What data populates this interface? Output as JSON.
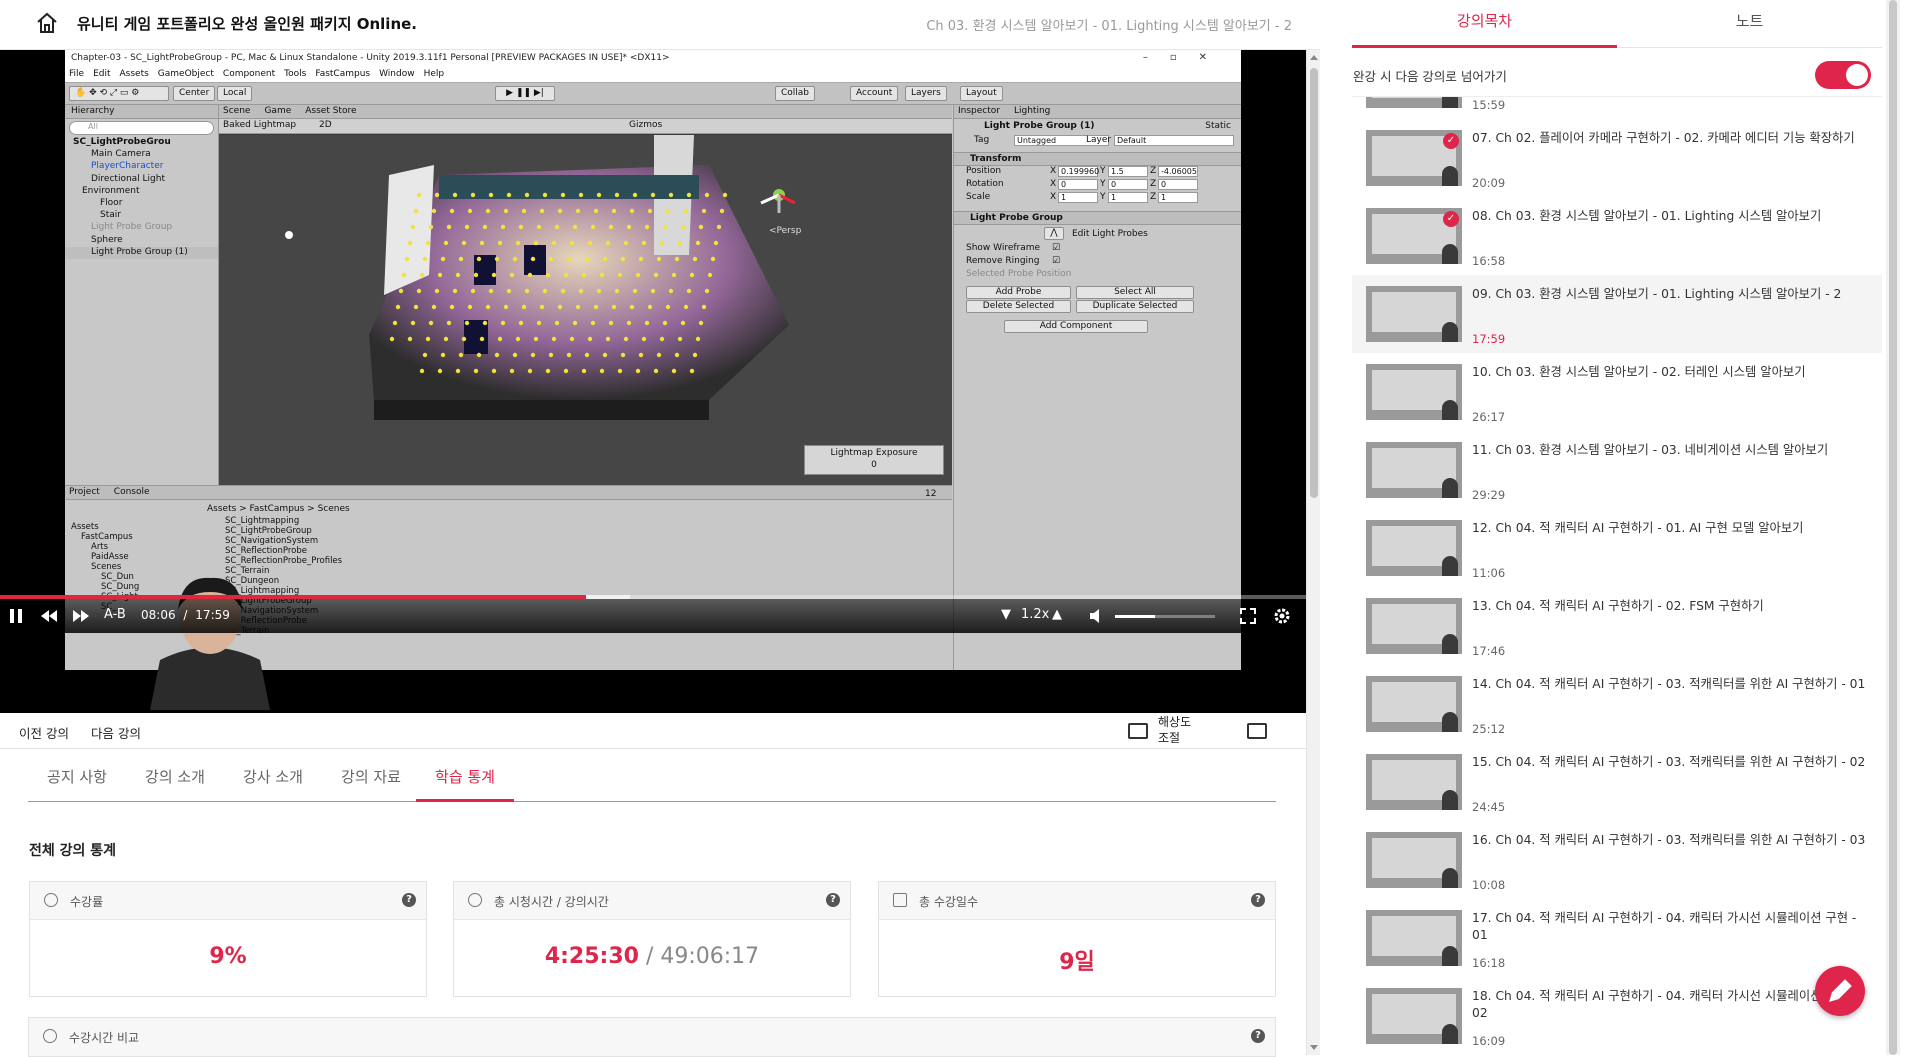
{
  "header": {
    "course_title": "유니티 게임 포트폴리오 완성 올인원 패키지 Online.",
    "chapter_title": "Ch 03. 환경 시스템 알아보기 - 01. Lighting 시스템 알아보기 - 2"
  },
  "unity": {
    "window_title": "Chapter-03 - SC_LightProbeGroup - PC, Mac & Linux Standalone - Unity 2019.3.11f1 Personal [PREVIEW PACKAGES IN USE]* <DX11>",
    "menu": [
      "File",
      "Edit",
      "Assets",
      "GameObject",
      "Component",
      "Tools",
      "FastCampus",
      "Window",
      "Help"
    ],
    "toolbar": {
      "center": "Center",
      "local": "Local",
      "collab": "Collab",
      "account": "Account",
      "layers": "Layers",
      "layout": "Layout"
    },
    "hierarchy_title": "Hierarchy",
    "search_all": "All",
    "hierarchy": [
      {
        "label": "SC_LightProbeGrou",
        "indent": 0,
        "style": "bold"
      },
      {
        "label": "Main Camera",
        "indent": 2,
        "style": ""
      },
      {
        "label": "PlayerCharacter",
        "indent": 2,
        "style": "blue"
      },
      {
        "label": "Directional Light",
        "indent": 2,
        "style": ""
      },
      {
        "label": "Environment",
        "indent": 1,
        "style": ""
      },
      {
        "label": "Floor",
        "indent": 3,
        "style": ""
      },
      {
        "label": "Stair",
        "indent": 3,
        "style": ""
      },
      {
        "label": "Light Probe Group",
        "indent": 2,
        "style": "grey"
      },
      {
        "label": "Sphere",
        "indent": 2,
        "style": ""
      },
      {
        "label": "Light Probe Group (1)",
        "indent": 2,
        "style": "sel"
      }
    ],
    "scene_tabs": [
      "Scene",
      "Game",
      "Asset Store"
    ],
    "scene_mode": "Baked Lightmap",
    "scene_2d": "2D",
    "gizmos": "Gizmos",
    "persp": "<Persp",
    "lightmap_exposure": "Lightmap Exposure",
    "lightmap_value": "0",
    "inspector_tabs": [
      "Inspector",
      "Lighting"
    ],
    "object_name": "Light Probe Group (1)",
    "static": "Static",
    "tag_label": "Tag",
    "tag_value": "Untagged",
    "layer_label": "Layer",
    "layer_value": "Default",
    "transform_title": "Transform",
    "position_label": "Position",
    "rotation_label": "Rotation",
    "scale_label": "Scale",
    "position": [
      "0.199960",
      "1.5",
      "-4.06005"
    ],
    "rotation": [
      "0",
      "0",
      "0"
    ],
    "scale": [
      "1",
      "1",
      "1"
    ],
    "lpg_title": "Light Probe Group",
    "edit_light_probes": "Edit Light Probes",
    "show_wireframe": "Show Wireframe",
    "remove_ringing": "Remove Ringing",
    "selected_probe_position": "Selected Probe Position",
    "add_probe": "Add Probe",
    "select_all": "Select All",
    "delete_selected": "Delete Selected",
    "duplicate_selected": "Duplicate Selected",
    "add_component": "Add Component",
    "project_tabs": [
      "Project",
      "Console"
    ],
    "breadcrumb": "Assets > FastCampus > Scenes",
    "folders": [
      "Assets",
      "FastCampus",
      "Arts",
      "PaidAsse",
      "Scenes",
      "SC_Dun",
      "SC_Dung",
      "SC_Light",
      "SC_"
    ],
    "files": [
      "SC_Lightmapping",
      "SC_LightProbeGroup",
      "SC_NavigationSystem",
      "SC_ReflectionProbe",
      "SC_ReflectionProbe_Profiles",
      "SC_Terrain",
      "SC_Dungeon",
      "SC_Lightmapping",
      "SC_LightProbeGroup",
      "SC_NavigationSystem",
      "SC_ReflectionProbe",
      "SC_Terrain"
    ],
    "item_count": "12"
  },
  "player": {
    "ab": "A-B",
    "current_time": "08:06",
    "separator": "/",
    "duration": "17:59",
    "speed": "1.2x",
    "progress": 0.449
  },
  "subbar": {
    "prev": "이전 강의",
    "next": "다음 강의",
    "resolution": "해상도\n조절"
  },
  "tabs": [
    "공지 사항",
    "강의 소개",
    "강사 소개",
    "강의 자료",
    "학습 통계"
  ],
  "active_tab": 4,
  "stats": {
    "title": "전체 강의 통계",
    "cards": [
      {
        "label": "수강률",
        "value": "9%",
        "muted": ""
      },
      {
        "label": "총 시청시간 / 강의시간",
        "value": "4:25:30",
        "muted": " / 49:06:17"
      },
      {
        "label": "총 수강일수",
        "value": "9일",
        "muted": ""
      }
    ],
    "compare_label": "수강시간 비교"
  },
  "rpanel": {
    "tabs": [
      "강의목차",
      "노트"
    ],
    "autoplay_label": "완강 시 다음 강의로 넘어가기",
    "autoplay_on": true,
    "items": [
      {
        "title": "",
        "time": "15:59",
        "checked": false,
        "current": false
      },
      {
        "title": "07. Ch 02. 플레이어 카메라 구현하기 - 02. 카메라 에디터 기능 확장하기",
        "time": "20:09",
        "checked": true,
        "current": false
      },
      {
        "title": "08. Ch 03. 환경 시스템 알아보기 - 01. Lighting 시스템 알아보기",
        "time": "16:58",
        "checked": true,
        "current": false
      },
      {
        "title": "09. Ch 03. 환경 시스템 알아보기 - 01. Lighting 시스템 알아보기 - 2",
        "time": "17:59",
        "checked": false,
        "current": true
      },
      {
        "title": "10. Ch 03. 환경 시스템 알아보기 - 02. 터레인 시스템 알아보기",
        "time": "26:17",
        "checked": false,
        "current": false
      },
      {
        "title": "11. Ch 03. 환경 시스템 알아보기 - 03. 네비게이션 시스템 알아보기",
        "time": "29:29",
        "checked": false,
        "current": false
      },
      {
        "title": "12. Ch 04. 적 캐릭터 AI 구현하기 - 01. AI 구현 모델 알아보기",
        "time": "11:06",
        "checked": false,
        "current": false
      },
      {
        "title": "13. Ch 04. 적 캐릭터 AI 구현하기 - 02. FSM 구현하기",
        "time": "17:46",
        "checked": false,
        "current": false
      },
      {
        "title": "14. Ch 04. 적 캐릭터 AI 구현하기 - 03. 적캐릭터를 위한 AI 구현하기 - 01",
        "time": "25:12",
        "checked": false,
        "current": false
      },
      {
        "title": "15. Ch 04. 적 캐릭터 AI 구현하기 - 03. 적캐릭터를 위한 AI 구현하기 - 02",
        "time": "24:45",
        "checked": false,
        "current": false
      },
      {
        "title": "16. Ch 04. 적 캐릭터 AI 구현하기 - 03. 적캐릭터를 위한 AI 구현하기 - 03",
        "time": "10:08",
        "checked": false,
        "current": false
      },
      {
        "title": "17. Ch 04. 적 캐릭터 AI 구현하기 - 04. 캐릭터 가시선 시뮬레이션 구현 - 01",
        "time": "16:18",
        "checked": false,
        "current": false
      },
      {
        "title": "18. Ch 04. 적 캐릭터 AI 구현하기 - 04. 캐릭터 가시선 시뮬레이션 구현 - 02",
        "time": "16:09",
        "checked": false,
        "current": false
      }
    ]
  },
  "colors": {
    "accent": "#e0254a",
    "progress": "#e0253e"
  },
  "icons": [
    "home-icon",
    "pause-icon",
    "rewind-icon",
    "forward-icon",
    "volume-icon",
    "fullscreen-icon",
    "settings-icon",
    "resolution-icon",
    "popout-icon",
    "help-icon",
    "pencil-icon",
    "check-icon"
  ]
}
